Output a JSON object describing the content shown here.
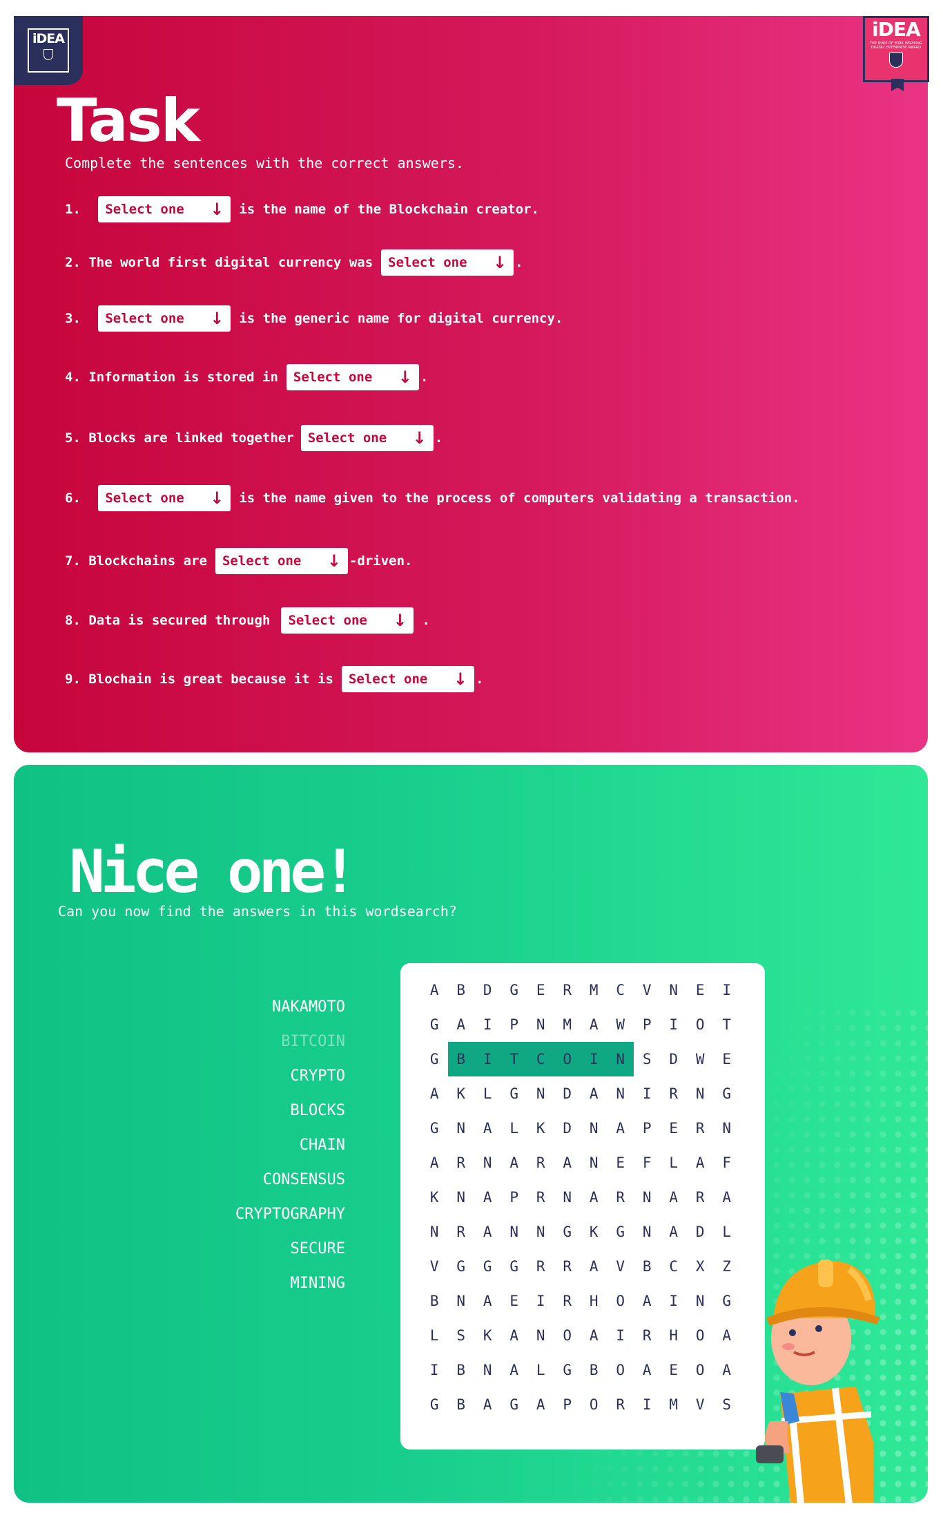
{
  "task": {
    "title": "Task",
    "subtitle": "Complete the sentences with the correct answers.",
    "select_placeholder": "Select one",
    "questions": [
      {
        "num": "1.",
        "before": "",
        "after": "is the name of the Blockchain creator."
      },
      {
        "num": "2.",
        "before": "The world first digital currency was",
        "after": "."
      },
      {
        "num": "3.",
        "before": "",
        "after": "is the generic name for digital currency."
      },
      {
        "num": "4.",
        "before": "Information is stored in",
        "after": "."
      },
      {
        "num": "5.",
        "before": "Blocks are linked together",
        "after": "."
      },
      {
        "num": "6.",
        "before": "",
        "after": "is the name given to the process of computers validating a transaction."
      },
      {
        "num": "7.",
        "before": "Blockchains are",
        "after": "-driven."
      },
      {
        "num": "8.",
        "before": "Data is secured through",
        "after": "."
      },
      {
        "num": "9.",
        "before": "Blochain is great because it is",
        "after": "."
      }
    ]
  },
  "logos": {
    "left_text": "iDEA",
    "right_text": "iDEA",
    "right_sub": "THE DUKE OF YORK INSPIRING DIGITAL ENTERPRISE AWARD"
  },
  "success": {
    "title": "Nice one!",
    "subtitle": "Can you now find the answers in this wordsearch?",
    "words": [
      {
        "text": "NAKAMOTO",
        "found": false
      },
      {
        "text": "BITCOIN",
        "found": true
      },
      {
        "text": "CRYPTO",
        "found": false
      },
      {
        "text": "BLOCKS",
        "found": false
      },
      {
        "text": "CHAIN",
        "found": false
      },
      {
        "text": "CONSENSUS",
        "found": false
      },
      {
        "text": "CRYPTOGRAPHY",
        "found": false
      },
      {
        "text": "SECURE",
        "found": false
      },
      {
        "text": "MINING",
        "found": false
      }
    ],
    "grid": [
      "ABDGERMCVNEI",
      "GAIPNMAWPIOT",
      "GBITCOINSDWE",
      "AKLGNDANIRNG",
      "GNALKDNAPERN",
      "ARNARANEFLAF",
      "KNAPRNARNARA",
      "NRANNGKGNADL",
      "VGGGRRAVBCXZ",
      "BNAEIRHOAING",
      "LSKANOAIRHOA",
      "IBNALGBOAEOA",
      "GBAGAPORIMVS"
    ],
    "highlight": {
      "row": 2,
      "col_start": 1,
      "col_end": 7
    },
    "highlight_color": "#10a882"
  },
  "colors": {
    "task_gradient_start": "#c6053b",
    "task_gradient_end": "#ea3385",
    "success_gradient_start": "#10c184",
    "success_gradient_end": "#2fe897",
    "navy": "#2b2f5c",
    "select_text": "#c4073d"
  }
}
